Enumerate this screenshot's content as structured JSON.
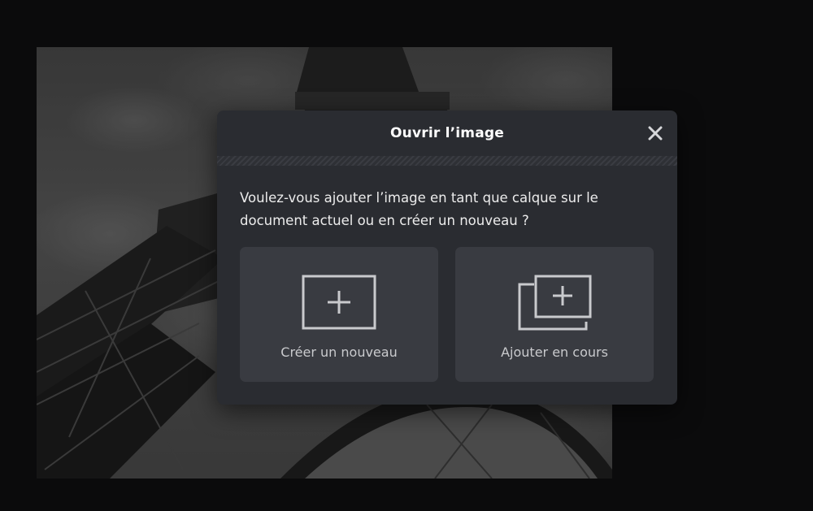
{
  "dialog": {
    "title": "Ouvrir l’image",
    "message": "Voulez-vous ajouter l’image en tant que calque sur le document actuel ou en créer un nouveau ?",
    "close_icon": "close-icon",
    "options": [
      {
        "label": "Créer un nouveau",
        "icon": "new-document-icon"
      },
      {
        "label": "Ajouter en cours",
        "icon": "add-layer-icon"
      }
    ]
  },
  "canvas": {
    "image_subject": "Eiffel Tower, black and white photo"
  },
  "colors": {
    "backdrop": "#0b0b0c",
    "dialog_bg": "#2a2c31",
    "card_bg": "#393b41",
    "title_text": "#ffffff",
    "body_text": "#ececec",
    "card_text": "#c9cacd"
  }
}
